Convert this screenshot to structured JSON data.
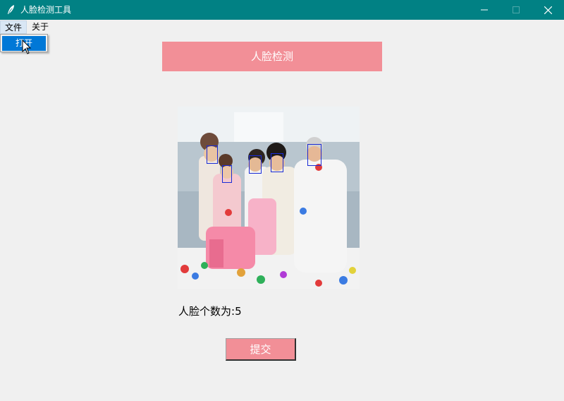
{
  "window": {
    "title": "人脸检测工具",
    "titlebar_color": "#018184",
    "icon": "feather-icon",
    "controls": [
      "minimize-icon",
      "maximize-icon",
      "close-icon"
    ]
  },
  "menubar": {
    "items": [
      {
        "label": "文件"
      },
      {
        "label": "关于"
      }
    ]
  },
  "file_menu": {
    "items": [
      {
        "label": "打开"
      }
    ]
  },
  "main": {
    "header_label": "人脸检测",
    "accent_color": "#f28f97",
    "image": {
      "description_icon": "family-photo",
      "detected_faces": 5
    },
    "count_prefix": "人脸个数为:",
    "count_value": "5",
    "submit_label": "提交"
  }
}
